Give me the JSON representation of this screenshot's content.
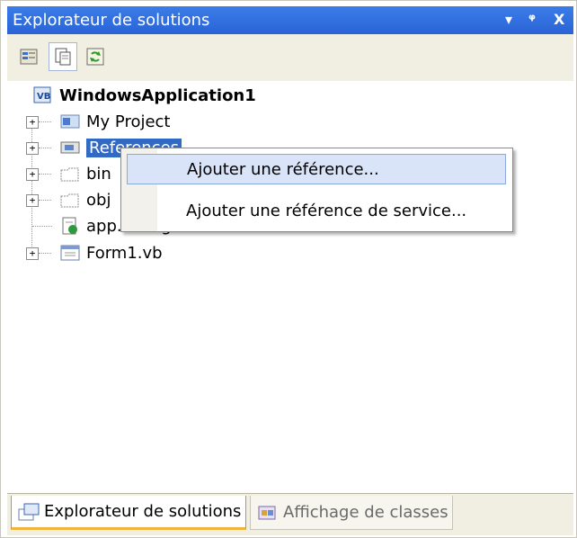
{
  "window": {
    "title": "Explorateur de solutions",
    "controls": [
      "▾",
      "ᵠ",
      "X"
    ]
  },
  "toolbar": {
    "buttons": [
      {
        "name": "properties-icon"
      },
      {
        "name": "show-all-files-icon"
      },
      {
        "name": "refresh-icon"
      }
    ]
  },
  "tree": {
    "root": "WindowsApplication1",
    "items": [
      {
        "label": "My Project"
      },
      {
        "label": "References"
      },
      {
        "label": "bin"
      },
      {
        "label": "obj"
      },
      {
        "label": "app.config"
      },
      {
        "label": "Form1.vb"
      }
    ]
  },
  "context_menu": {
    "items": [
      {
        "label": "Ajouter une référence..."
      },
      {
        "label": "Ajouter une référence de service..."
      }
    ]
  },
  "tabs": [
    {
      "label": "Explorateur de solutions"
    },
    {
      "label": "Affichage de classes"
    }
  ],
  "colors": {
    "title_bar": "#2a63d6",
    "selection": "#316ac5",
    "menu_highlight": "#d9e4f8",
    "active_tab_accent": "#f1b43c"
  }
}
